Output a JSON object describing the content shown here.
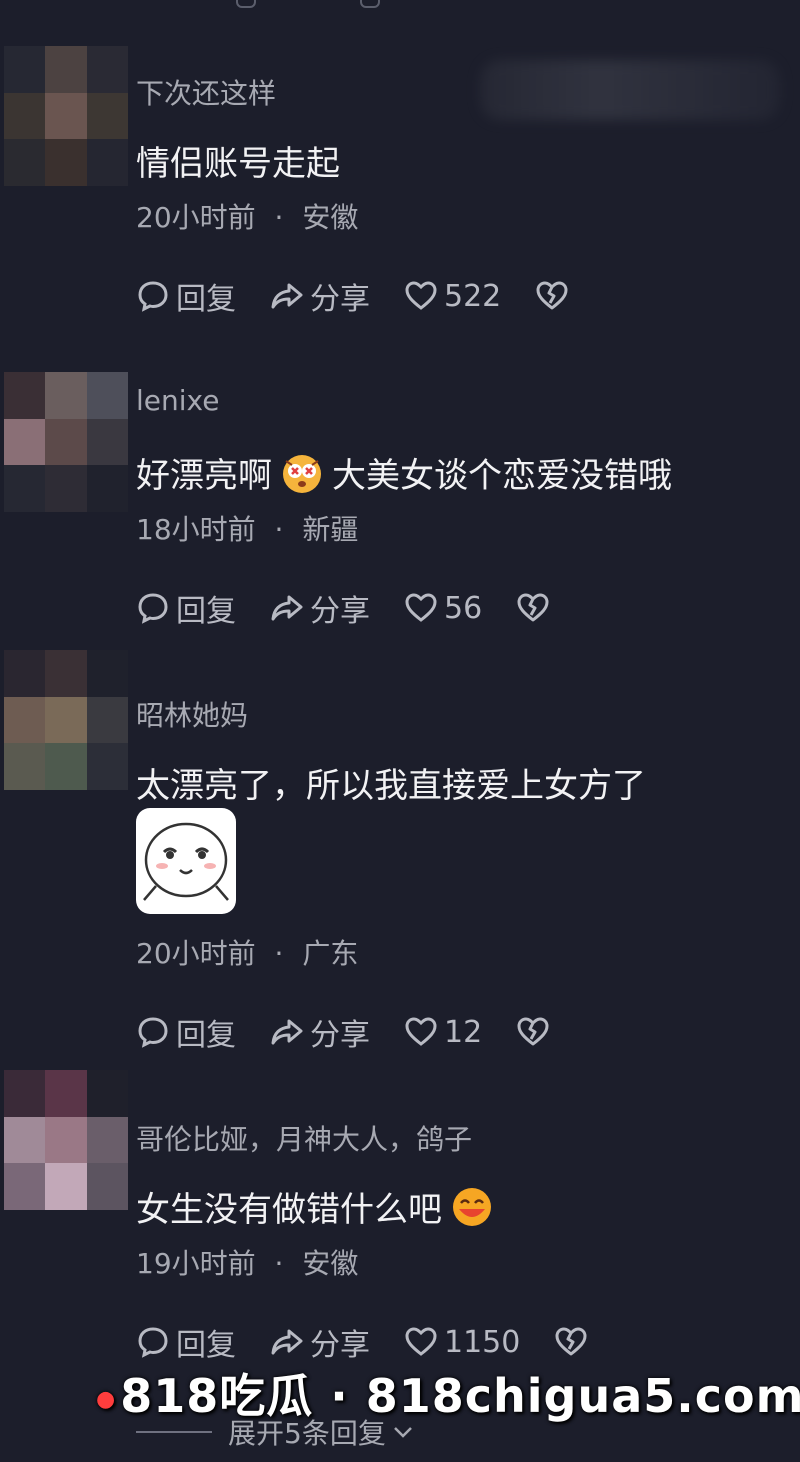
{
  "actions": {
    "reply_label": "回复",
    "share_label": "分享"
  },
  "comments": [
    {
      "username": "下次还这样",
      "text": "情侣账号走起",
      "time": "20小时前",
      "location": "安徽",
      "likes": "522"
    },
    {
      "username": "lenixe",
      "text_before": "好漂亮啊",
      "text_after": "大美女谈个恋爱没错哦",
      "time": "18小时前",
      "location": "新疆",
      "likes": "56"
    },
    {
      "username": "昭林她妈",
      "text": "太漂亮了，所以我直接爱上女方了",
      "time": "20小时前",
      "location": "广东",
      "likes": "12"
    },
    {
      "username": "哥伦比娅，月神大人，鸽子",
      "text": "女生没有做错什么吧",
      "time": "19小时前",
      "location": "安徽",
      "likes": "1150"
    }
  ],
  "expand_replies": "展开5条回复",
  "separator": "·",
  "watermark": "818吃瓜 · 818chigua5.com",
  "colors": {
    "background": "#1c1e2b",
    "secondary_text": "#a7a9b2",
    "primary_text": "#f2f2f4"
  }
}
